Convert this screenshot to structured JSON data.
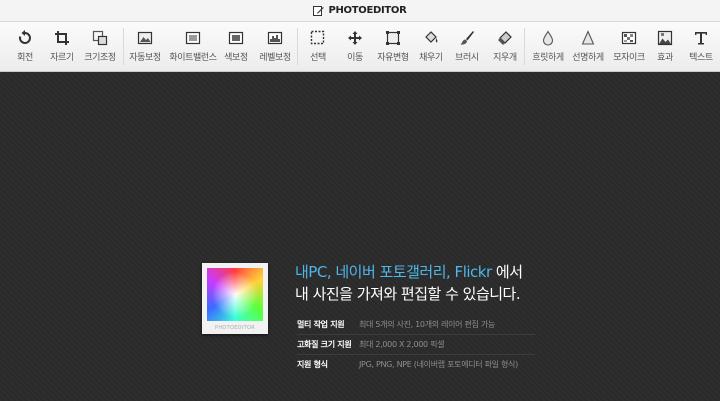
{
  "app": {
    "logo_text": "PHOTOEDITOR"
  },
  "toolbar": {
    "tools": [
      {
        "label": "회전",
        "icon": "rotate-icon"
      },
      {
        "label": "자르기",
        "icon": "crop-icon"
      },
      {
        "label": "크기조정",
        "icon": "resize-icon"
      },
      {
        "label": "자동보정",
        "icon": "auto-correct-icon"
      },
      {
        "label": "화이트밸런스",
        "icon": "white-balance-icon"
      },
      {
        "label": "색보정",
        "icon": "color-correct-icon"
      },
      {
        "label": "레벨보정",
        "icon": "levels-icon"
      },
      {
        "label": "선택",
        "icon": "selection-icon"
      },
      {
        "label": "이동",
        "icon": "move-icon"
      },
      {
        "label": "자유변형",
        "icon": "free-transform-icon"
      },
      {
        "label": "채우기",
        "icon": "paint-bucket-icon"
      },
      {
        "label": "브러시",
        "icon": "brush-icon"
      },
      {
        "label": "지우개",
        "icon": "eraser-icon"
      },
      {
        "label": "흐릿하게",
        "icon": "blur-icon"
      },
      {
        "label": "선명하게",
        "icon": "sharpen-icon"
      },
      {
        "label": "모자이크",
        "icon": "mosaic-icon"
      },
      {
        "label": "효과",
        "icon": "effects-icon"
      },
      {
        "label": "텍스트",
        "icon": "text-icon"
      }
    ]
  },
  "intro": {
    "thumbnail_caption": "PHOTOEDITOR",
    "headline_highlight": "내PC, 네이버 포토갤러리, Flickr",
    "headline_rest": " 에서",
    "headline_line2": "내 사진을 가져와 편집할 수 있습니다.",
    "info": [
      {
        "key": "멀티 작업 지원",
        "value": "최대 5개의 사진, 10개의 레이어 편집 가능"
      },
      {
        "key": "고화질 크기 지원",
        "value": "최대 2,000 X 2,000 픽셀"
      },
      {
        "key": "지원 형식",
        "value": "JPG, PNG, NPE (네이버랩 포토에디터 파일 형식)"
      }
    ]
  }
}
